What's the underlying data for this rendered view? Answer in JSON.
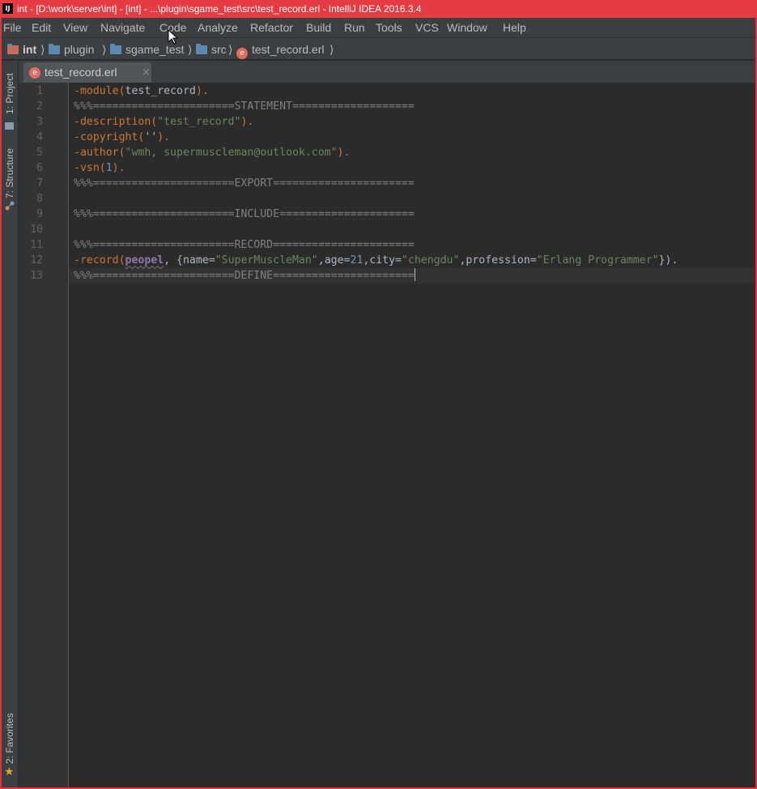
{
  "window": {
    "app_icon": "IJ",
    "title": "int - [D:\\work\\server\\int] - [int] - ...\\plugin\\sgame_test\\src\\test_record.erl - IntelliJ IDEA 2016.3.4"
  },
  "menu": [
    "File",
    "Edit",
    "View",
    "Navigate",
    "Code",
    "Analyze",
    "Refactor",
    "Build",
    "Run",
    "Tools",
    "VCS",
    "Window",
    "Help"
  ],
  "breadcrumbs": [
    "int",
    "plugin",
    "sgame_test",
    "src",
    "test_record.erl"
  ],
  "tool_windows": {
    "project": "1: Project",
    "structure": "7: Structure",
    "favorites": "2: Favorites"
  },
  "editor_tab": {
    "label": "test_record.erl",
    "close": "×",
    "icon": "erlang-file-icon",
    "icon_letter": "e"
  },
  "line_numbers": [
    "1",
    "2",
    "3",
    "4",
    "5",
    "6",
    "7",
    "8",
    "9",
    "10",
    "11",
    "12",
    "13"
  ],
  "code": {
    "l1": {
      "a": "-module(",
      "b": "test_record",
      "c": ")."
    },
    "l2": "%%%======================STATEMENT===================",
    "l3": {
      "a": "-description(",
      "b": "\"test_record\"",
      "c": ")."
    },
    "l4": {
      "a": "-copyright(",
      "b": "''",
      "c": ")."
    },
    "l5": {
      "a": "-author(",
      "b": "\"wmh, supermuscleman@outlook.com\"",
      "c": ")."
    },
    "l6": {
      "a": "-vsn(",
      "b": "1",
      "c": ")."
    },
    "l7": "%%%======================EXPORT======================",
    "l9": "%%%======================INCLUDE=====================",
    "l11": "%%%======================RECORD======================",
    "l12": {
      "a": "-record(",
      "rec": "peopel",
      "b": ", {name=",
      "s1": "\"SuperMuscleMan\"",
      "c": ",age=",
      "n1": "21",
      "d": ",city=",
      "s2": "\"chengdu\"",
      "e": ",profession=",
      "s3": "\"Erlang Programmer\"",
      "f": "})."
    },
    "l13": "%%%======================DEFINE======================"
  },
  "colors": {
    "title_bar": "#e43c42",
    "editor_bg": "#2b2b2b",
    "keyword": "#cc7832",
    "string": "#6a8759",
    "number": "#6897bb",
    "comment": "#808080",
    "record_name": "#9876aa"
  }
}
